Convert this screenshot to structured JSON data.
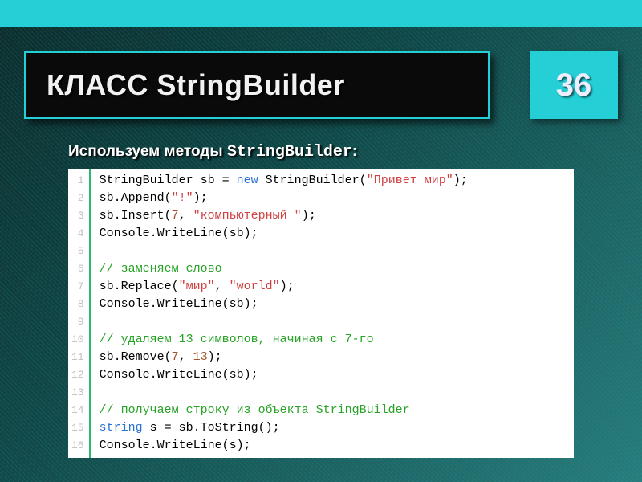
{
  "header": {
    "title": "КЛАСС StringBuilder"
  },
  "page_number": "36",
  "subtitle": {
    "text": "Используем методы ",
    "mono": "StringBuilder",
    "tail": ":"
  },
  "code": {
    "line_numbers": [
      "1",
      "2",
      "3",
      "4",
      "5",
      "6",
      "7",
      "8",
      "9",
      "10",
      "11",
      "12",
      "13",
      "14",
      "15",
      "16"
    ],
    "lines": [
      {
        "tokens": [
          [
            "",
            "StringBuilder sb = "
          ],
          [
            "kw",
            "new"
          ],
          [
            "",
            " StringBuilder("
          ],
          [
            "str",
            "\"Привет мир\""
          ],
          [
            "",
            ");"
          ]
        ]
      },
      {
        "tokens": [
          [
            "",
            "sb.Append("
          ],
          [
            "str",
            "\"!\""
          ],
          [
            "",
            ");"
          ]
        ]
      },
      {
        "tokens": [
          [
            "",
            "sb.Insert("
          ],
          [
            "num",
            "7"
          ],
          [
            "",
            ", "
          ],
          [
            "str",
            "\"компьютерный \""
          ],
          [
            "",
            ");"
          ]
        ]
      },
      {
        "tokens": [
          [
            "",
            "Console.WriteLine(sb);"
          ]
        ]
      },
      {
        "tokens": [
          [
            "",
            ""
          ]
        ]
      },
      {
        "tokens": [
          [
            "cmt",
            "// заменяем слово"
          ]
        ]
      },
      {
        "tokens": [
          [
            "",
            "sb.Replace("
          ],
          [
            "str",
            "\"мир\""
          ],
          [
            "",
            ", "
          ],
          [
            "str",
            "\"world\""
          ],
          [
            "",
            ");"
          ]
        ]
      },
      {
        "tokens": [
          [
            "",
            "Console.WriteLine(sb);"
          ]
        ]
      },
      {
        "tokens": [
          [
            "",
            ""
          ]
        ]
      },
      {
        "tokens": [
          [
            "cmt",
            "// удаляем 13 символов, начиная с 7-го"
          ]
        ]
      },
      {
        "tokens": [
          [
            "",
            "sb.Remove("
          ],
          [
            "num",
            "7"
          ],
          [
            "",
            ", "
          ],
          [
            "num",
            "13"
          ],
          [
            "",
            ");"
          ]
        ]
      },
      {
        "tokens": [
          [
            "",
            "Console.WriteLine(sb);"
          ]
        ]
      },
      {
        "tokens": [
          [
            "",
            ""
          ]
        ]
      },
      {
        "tokens": [
          [
            "cmt",
            "// получаем строку из объекта StringBuilder"
          ]
        ]
      },
      {
        "tokens": [
          [
            "kw",
            "string"
          ],
          [
            "",
            " s = sb.ToString();"
          ]
        ]
      },
      {
        "tokens": [
          [
            "",
            "Console.WriteLine(s);"
          ]
        ]
      }
    ]
  }
}
